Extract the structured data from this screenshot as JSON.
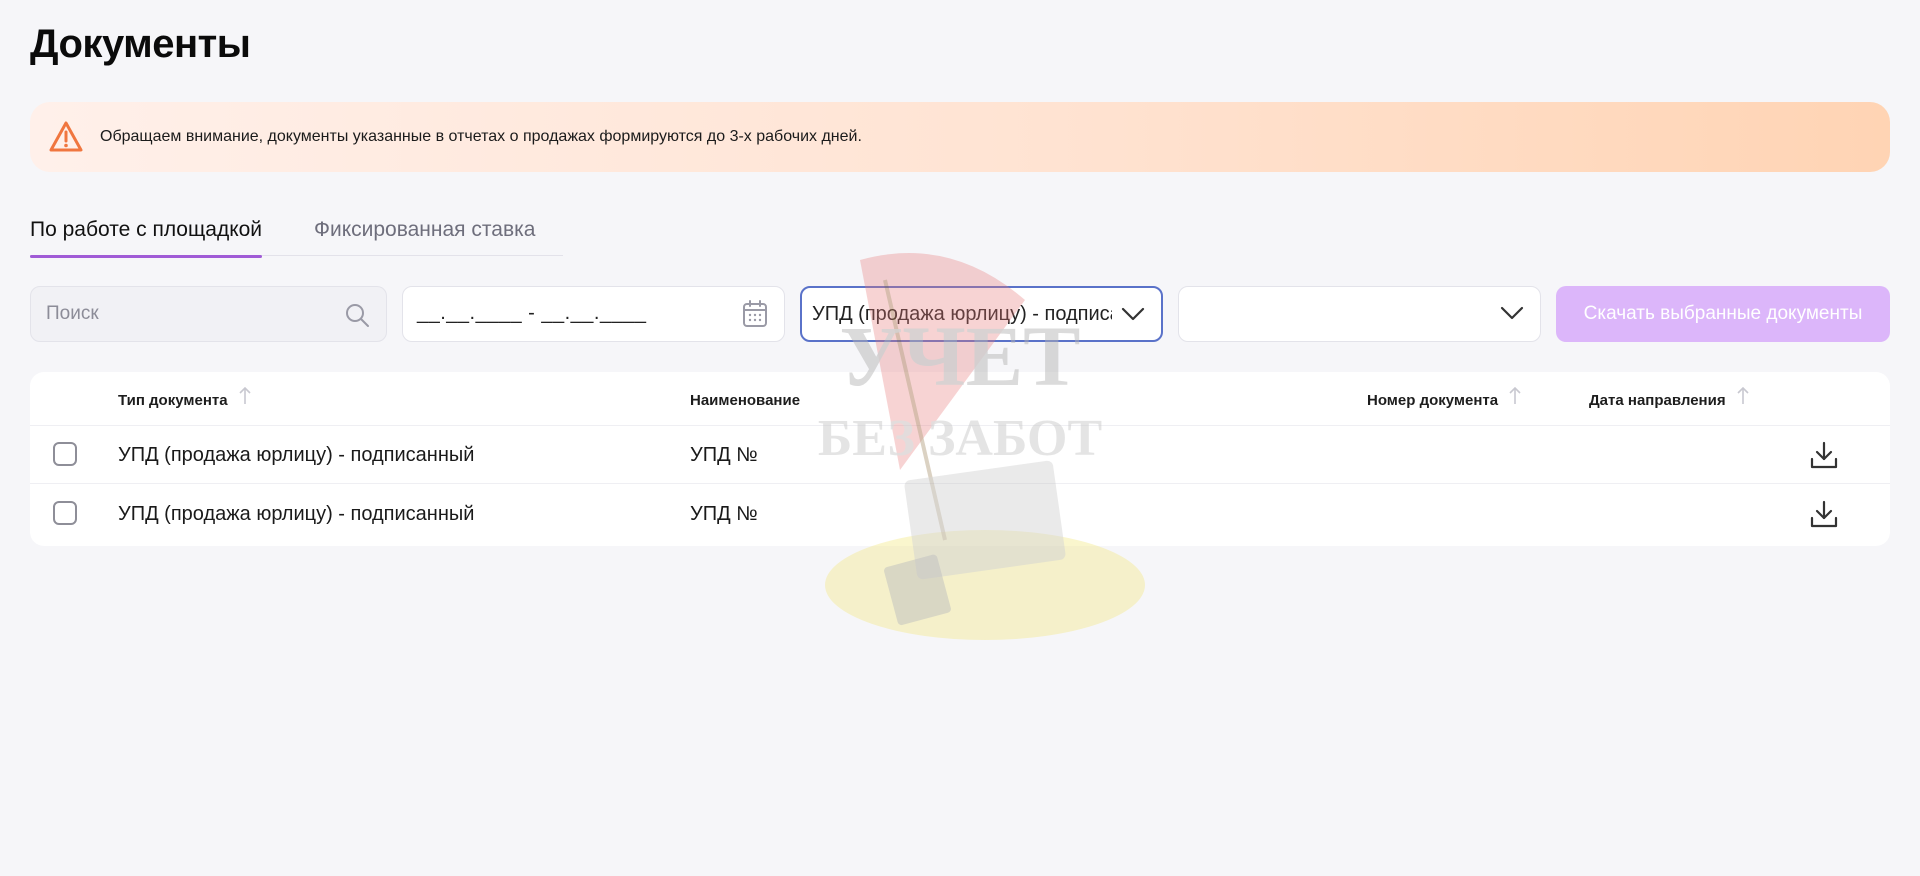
{
  "page": {
    "title": "Документы"
  },
  "notice": {
    "text": "Обращаем внимание, документы указанные в отчетах о продажах формируются до 3-х рабочих дней."
  },
  "tabs": [
    {
      "label": "По работе с площадкой",
      "active": true
    },
    {
      "label": "Фиксированная ставка",
      "active": false
    }
  ],
  "filters": {
    "search_placeholder": "Поиск",
    "date_mask": "__.__.____ - __.__.____",
    "doc_type_selected": "УПД (продажа юрлицу) - подписанный",
    "second_select_value": ""
  },
  "download_selected_label": "Скачать выбранные документы",
  "table": {
    "headers": {
      "type": "Тип документа",
      "name": "Наименование",
      "number": "Номер документа",
      "date": "Дата направления"
    },
    "rows": [
      {
        "type": "УПД (продажа юрлицу) - подписанный",
        "name": "УПД №",
        "number": "",
        "date": ""
      },
      {
        "type": "УПД (продажа юрлицу) - подписанный",
        "name": "УПД №",
        "number": "",
        "date": ""
      }
    ]
  },
  "watermark": {
    "line1": "УЧЕТ",
    "line2": "БЕЗ ЗАБОТ"
  },
  "colors": {
    "accent": "#a05bd6",
    "button_disabled": "#dcb6fa",
    "warning": "#f0763f",
    "focus_border": "#5a72c9",
    "background": "#f6f6f9"
  },
  "icons": [
    "warning-icon",
    "search-icon",
    "calendar-icon",
    "chevron-down-icon",
    "sort-arrow-icon",
    "download-icon",
    "checkbox"
  ]
}
